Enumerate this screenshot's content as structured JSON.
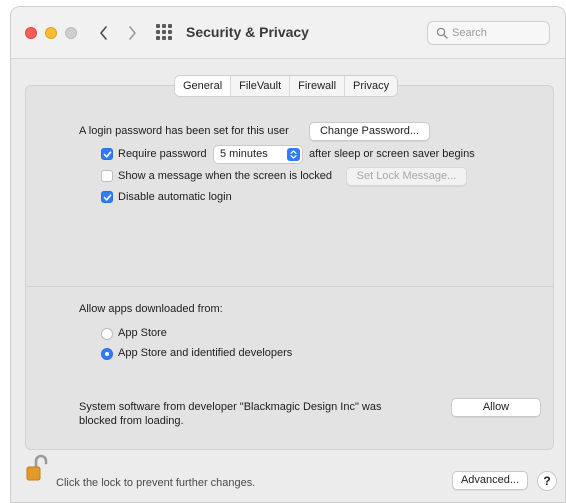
{
  "window": {
    "title": "Security & Privacy"
  },
  "search": {
    "placeholder": "Search"
  },
  "tabs": [
    {
      "label": "General",
      "active": true
    },
    {
      "label": "FileVault",
      "active": false
    },
    {
      "label": "Firewall",
      "active": false
    },
    {
      "label": "Privacy",
      "active": false
    }
  ],
  "general": {
    "login_password_text": "A login password has been set for this user",
    "change_password_label": "Change Password...",
    "require_password": {
      "label": "Require password",
      "checked": true,
      "selected": "5 minutes",
      "suffix": "after sleep or screen saver begins"
    },
    "show_message": {
      "label": "Show a message when the screen is locked",
      "checked": false,
      "button_label": "Set Lock Message..."
    },
    "disable_auto_login": {
      "label": "Disable automatic login",
      "checked": true
    }
  },
  "apps": {
    "heading": "Allow apps downloaded from:",
    "options": [
      {
        "label": "App Store",
        "selected": false
      },
      {
        "label": "App Store and identified developers",
        "selected": true
      }
    ]
  },
  "blocked": {
    "line1": "System software from developer \"Blackmagic Design Inc\" was",
    "line2": "blocked from loading.",
    "allow_label": "Allow"
  },
  "footer": {
    "lock_text": "Click the lock to prevent further changes.",
    "advanced_label": "Advanced...",
    "help_label": "?"
  },
  "colors": {
    "accent": "#2f7cf6",
    "close": "#fe5f57",
    "minimize": "#febc2e"
  }
}
